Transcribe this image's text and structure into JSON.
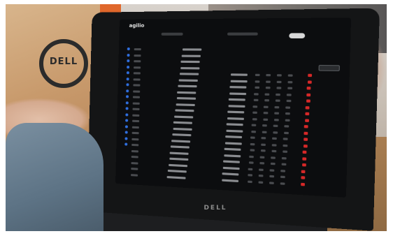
{
  "scene": {
    "box_logo": "DELL",
    "laptop_brand": "DELL"
  },
  "screen": {
    "app_title": "agilio"
  },
  "colors": {
    "accent_blue": "#2f6fe0",
    "status_red": "#d62828",
    "screen_bg": "#0c0d0f"
  }
}
